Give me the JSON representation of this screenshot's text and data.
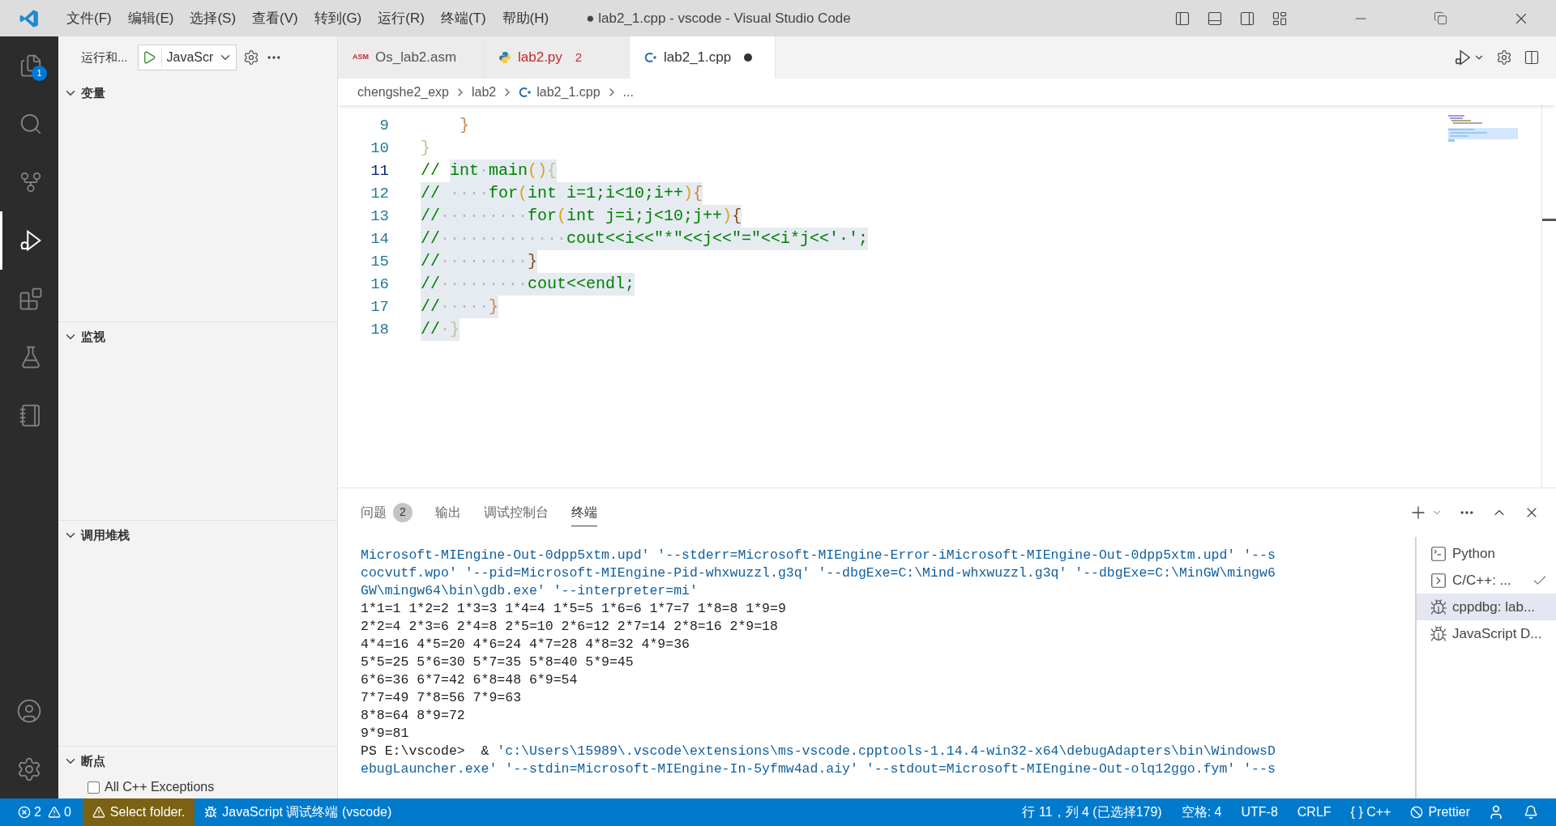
{
  "window": {
    "title": "● lab2_1.cpp - vscode - Visual Studio Code"
  },
  "menu": [
    "文件(F)",
    "编辑(E)",
    "选择(S)",
    "查看(V)",
    "转到(G)",
    "运行(R)",
    "终端(T)",
    "帮助(H)"
  ],
  "activity_bar": [
    {
      "kind": "explorer",
      "selected": false,
      "badge": "1"
    },
    {
      "kind": "search",
      "selected": false
    },
    {
      "kind": "scm",
      "selected": false
    },
    {
      "kind": "debug",
      "selected": true
    },
    {
      "kind": "extensions",
      "selected": false
    },
    {
      "kind": "testing",
      "selected": false
    },
    {
      "kind": "notebook",
      "selected": false
    }
  ],
  "sidebar": {
    "title": "运行和...",
    "config": "JavaScr",
    "sections": [
      {
        "title": "变量",
        "expanded": true
      },
      {
        "title": "监视",
        "expanded": true
      },
      {
        "title": "调用堆栈",
        "expanded": true
      },
      {
        "title": "断点",
        "expanded": true,
        "items": [
          {
            "label": "All C++ Exceptions",
            "checked": false
          }
        ]
      }
    ]
  },
  "tabs": [
    {
      "label": "Os_lab2.asm",
      "kind": "asm",
      "icon_text": "ASM",
      "selected": false,
      "error": false,
      "modified": false
    },
    {
      "label": "lab2.py",
      "kind": "python",
      "count": "2",
      "selected": false,
      "error": true,
      "modified": false
    },
    {
      "label": "lab2_1.cpp",
      "kind": "cpp",
      "selected": true,
      "error": false,
      "modified": true
    }
  ],
  "breadcrumb": [
    {
      "label": "chengshe2_exp",
      "kind": "folder"
    },
    {
      "label": "lab2",
      "kind": "folder"
    },
    {
      "label": "lab2_1.cpp",
      "kind": "file"
    },
    {
      "label": "...",
      "kind": "symbol"
    }
  ],
  "code": [
    {
      "number": "9",
      "current": false,
      "segments": [
        {
          "text": "    }",
          "kind": "orange",
          "selected": false
        }
      ]
    },
    {
      "number": "10",
      "current": false,
      "segments": [
        {
          "text": "}",
          "kind": "pale",
          "selected": false
        }
      ]
    },
    {
      "number": "11",
      "current": true,
      "segments": [
        {
          "text": "// ",
          "kind": "comment",
          "selected": false
        },
        {
          "text": "int",
          "kind": "comment",
          "selected": true
        },
        {
          "text": "·",
          "kind": "ws",
          "selected": true
        },
        {
          "text": "main",
          "kind": "comment",
          "selected": true
        },
        {
          "text": "()",
          "kind": "gold",
          "selected": true
        },
        {
          "text": "{",
          "kind": "pale",
          "selected": true
        }
      ]
    },
    {
      "number": "12",
      "current": false,
      "segments": [
        {
          "text": "//",
          "kind": "comment",
          "selected": true
        },
        {
          "text": " ····",
          "kind": "ws",
          "selected": true
        },
        {
          "text": "for",
          "kind": "comment",
          "selected": true
        },
        {
          "text": "(",
          "kind": "gold",
          "selected": true
        },
        {
          "text": "int i=1;i<10;i++",
          "kind": "comment",
          "selected": true
        },
        {
          "text": ")",
          "kind": "gold",
          "selected": true
        },
        {
          "text": "{",
          "kind": "orange",
          "selected": true
        }
      ]
    },
    {
      "number": "13",
      "current": false,
      "segments": [
        {
          "text": "//",
          "kind": "comment",
          "selected": true
        },
        {
          "text": "·········",
          "kind": "ws",
          "selected": true
        },
        {
          "text": "for",
          "kind": "comment",
          "selected": true
        },
        {
          "text": "(",
          "kind": "gold",
          "selected": true
        },
        {
          "text": "int j=i;j<10;j++",
          "kind": "comment",
          "selected": true
        },
        {
          "text": ")",
          "kind": "gold",
          "selected": true
        },
        {
          "text": "{",
          "kind": "brown",
          "selected": true
        }
      ]
    },
    {
      "number": "14",
      "current": false,
      "segments": [
        {
          "text": "//",
          "kind": "comment",
          "selected": true
        },
        {
          "text": "·············",
          "kind": "ws",
          "selected": true
        },
        {
          "text": "cout<<i<<\"*\"<<j<<\"=\"<<i*j<<'·';",
          "kind": "comment",
          "selected": true
        }
      ]
    },
    {
      "number": "15",
      "current": false,
      "segments": [
        {
          "text": "//",
          "kind": "comment",
          "selected": true
        },
        {
          "text": "·········",
          "kind": "ws",
          "selected": true
        },
        {
          "text": "}",
          "kind": "brown",
          "selected": true
        }
      ]
    },
    {
      "number": "16",
      "current": false,
      "segments": [
        {
          "text": "//",
          "kind": "comment",
          "selected": true
        },
        {
          "text": "·········",
          "kind": "ws",
          "selected": true
        },
        {
          "text": "cout<<endl;",
          "kind": "comment",
          "selected": true
        }
      ]
    },
    {
      "number": "17",
      "current": false,
      "segments": [
        {
          "text": "//",
          "kind": "comment",
          "selected": true
        },
        {
          "text": "·····",
          "kind": "ws",
          "selected": true
        },
        {
          "text": "}",
          "kind": "orange",
          "selected": true
        }
      ]
    },
    {
      "number": "18",
      "current": false,
      "segments": [
        {
          "text": "//",
          "kind": "comment",
          "selected": true
        },
        {
          "text": "·",
          "kind": "ws",
          "selected": true
        },
        {
          "text": "}",
          "kind": "pale",
          "selected": true
        }
      ]
    }
  ],
  "panel": {
    "tabs": [
      {
        "label": "问题",
        "badge": "2",
        "selected": false
      },
      {
        "label": "输出",
        "selected": false
      },
      {
        "label": "调试控制台",
        "selected": false
      },
      {
        "label": "终端",
        "selected": true
      }
    ],
    "terminal": [
      [
        {
          "text": "Microsoft-MIEngine-Out-0dpp5xtm.upd' '--stderr=Microsoft-MIEngine-Error-iMicrosoft-MIEngine-Out-0dpp5xtm.upd' '--s",
          "kind": "string"
        }
      ],
      [
        {
          "text": "cocvutf.wpo' '--pid=Microsoft-MIEngine-Pid-whxwuzzl.g3q' '--dbgExe=C:\\Mind-whxwuzzl.g3q' '--dbgExe=C:\\MinGW\\mingw6",
          "kind": "string"
        }
      ],
      [
        {
          "text": "GW\\mingw64\\bin\\gdb.exe' '--interpreter=mi'",
          "kind": "string"
        }
      ],
      [
        {
          "text": "1*1=1 1*2=2 1*3=3 1*4=4 1*5=5 1*6=6 1*7=7 1*8=8 1*9=9",
          "kind": "plain"
        }
      ],
      [
        {
          "text": "2*2=4 2*3=6 2*4=8 2*5=10 2*6=12 2*7=14 2*8=16 2*9=18",
          "kind": "plain"
        }
      ],
      [
        {
          "text": "4*4=16 4*5=20 4*6=24 4*7=28 4*8=32 4*9=36",
          "kind": "plain"
        }
      ],
      [
        {
          "text": "5*5=25 5*6=30 5*7=35 5*8=40 5*9=45",
          "kind": "plain"
        }
      ],
      [
        {
          "text": "6*6=36 6*7=42 6*8=48 6*9=54",
          "kind": "plain"
        }
      ],
      [
        {
          "text": "7*7=49 7*8=56 7*9=63",
          "kind": "plain"
        }
      ],
      [
        {
          "text": "8*8=64 8*9=72",
          "kind": "plain"
        }
      ],
      [
        {
          "text": "9*9=81",
          "kind": "plain"
        }
      ],
      [
        {
          "text": "PS E:\\vscode>  & ",
          "kind": "plain"
        },
        {
          "text": "'c:\\Users\\15989\\.vscode\\extensions\\ms-vscode.cpptools-1.14.4-win32-x64\\debugAdapters\\bin\\WindowsD",
          "kind": "string"
        }
      ],
      [
        {
          "text": "ebugLauncher.exe' '--stdin=Microsoft-MIEngine-In-5yfmw4ad.aiy' '--stdout=Microsoft-MIEngine-Out-olq12ggo.fym' '--s",
          "kind": "string"
        }
      ]
    ],
    "terminals": [
      {
        "label": "Python",
        "kind": "shell",
        "selected": false,
        "checked": false
      },
      {
        "label": "C/C++: ...",
        "kind": "task",
        "selected": false,
        "checked": true
      },
      {
        "label": "cppdbg: lab...",
        "kind": "debug",
        "selected": true,
        "checked": false
      },
      {
        "label": "JavaScript D...",
        "kind": "debug",
        "selected": false,
        "checked": false
      }
    ]
  },
  "status_bar": {
    "left": [
      {
        "kind": "errors",
        "text": "2"
      },
      {
        "kind": "warnings",
        "text": "0"
      },
      {
        "kind": "notice",
        "text": "Select folder."
      },
      {
        "kind": "debug",
        "text": "JavaScript 调试终端 (vscode)"
      }
    ],
    "right": [
      {
        "kind": "text",
        "text": "行 11，列 4 (已选择179)"
      },
      {
        "kind": "text",
        "text": "空格: 4"
      },
      {
        "kind": "text",
        "text": "UTF-8"
      },
      {
        "kind": "text",
        "text": "CRLF"
      },
      {
        "kind": "text",
        "text": "{ } C++"
      },
      {
        "kind": "prettier",
        "text": "Prettier"
      },
      {
        "kind": "account"
      },
      {
        "kind": "bell"
      }
    ]
  }
}
